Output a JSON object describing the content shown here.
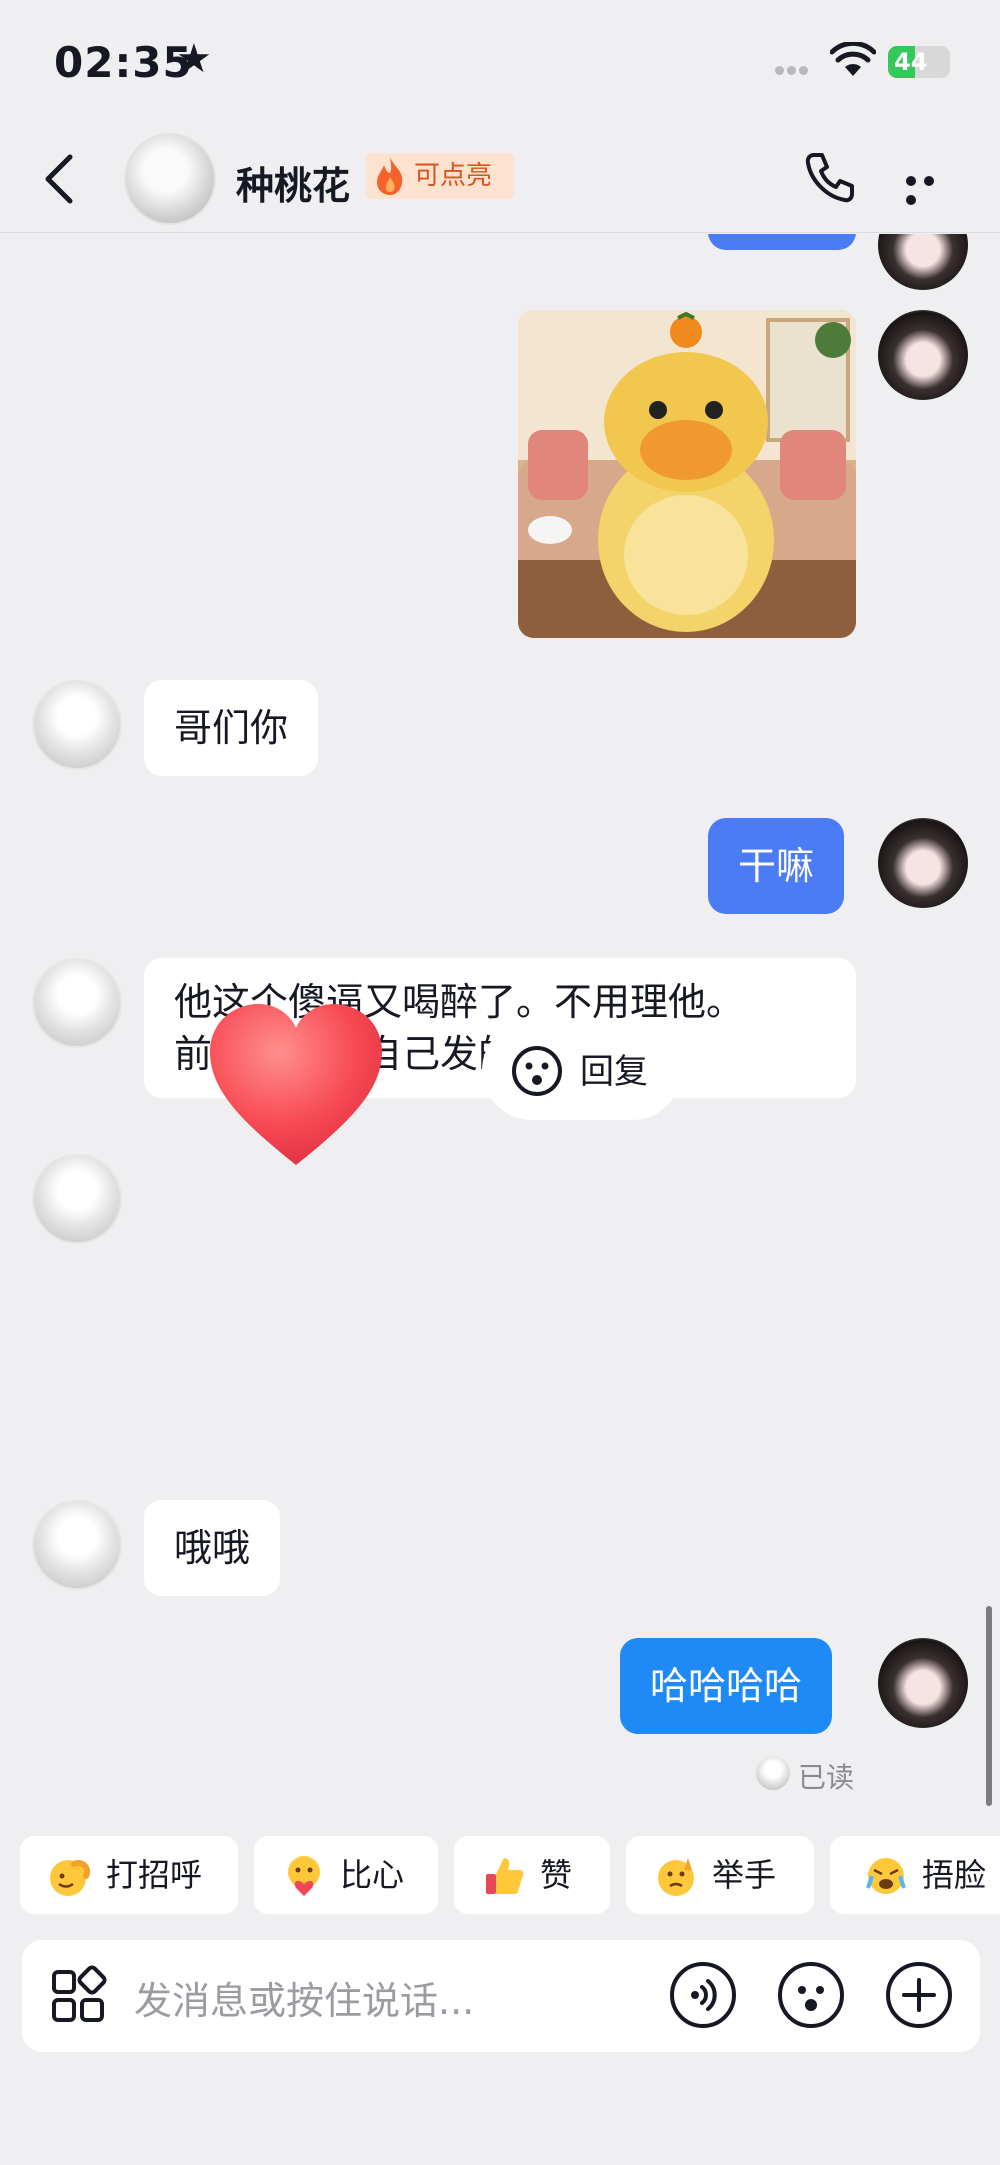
{
  "status_bar": {
    "time": "02:35",
    "battery": "44",
    "battery_level": 0.44
  },
  "header": {
    "contact_name": "种桃花",
    "badge_label": "可点亮"
  },
  "messages": [
    {
      "side": "right",
      "type": "image",
      "description": "cartoon yellow creature sticker"
    },
    {
      "side": "left",
      "type": "text",
      "text": "哥们你"
    },
    {
      "side": "right",
      "type": "text",
      "text": "干嘛"
    },
    {
      "side": "left",
      "type": "text",
      "lines": [
        "他这个傻逼又喝醉了。不用理他。",
        "前面都是他自己发的🙄。"
      ]
    },
    {
      "side": "left",
      "type": "sticker",
      "description": "red heart"
    },
    {
      "side": "left",
      "type": "text",
      "text": "哦哦"
    },
    {
      "side": "right",
      "type": "text",
      "text": "哈哈哈哈"
    }
  ],
  "reply_chip": {
    "label": "回复"
  },
  "read_receipt": {
    "label": "已读"
  },
  "quick_reactions": [
    {
      "label": "打招呼",
      "icon": "wave-emoji-icon"
    },
    {
      "label": "比心",
      "icon": "heart-hands-emoji-icon"
    },
    {
      "label": "赞",
      "icon": "thumbs-up-emoji-icon"
    },
    {
      "label": "举手",
      "icon": "raise-hand-emoji-icon"
    },
    {
      "label": "捂脸",
      "icon": "facepalm-emoji-icon"
    }
  ],
  "input_bar": {
    "placeholder": "发消息或按住说话..."
  },
  "colors": {
    "out_bubble": "#4b7cf6",
    "out_bubble_latest": "#1f8af5",
    "badge_text": "#d9531e",
    "background": "#efeff1"
  }
}
